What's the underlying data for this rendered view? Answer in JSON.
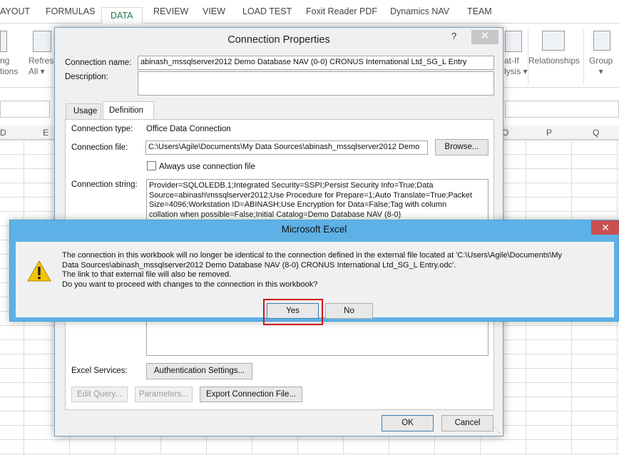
{
  "ribbon_tabs": [
    "AYOUT",
    "FORMULAS",
    "DATA",
    "REVIEW",
    "VIEW",
    "LOAD TEST",
    "Foxit Reader PDF",
    "Dynamics NAV",
    "TEAM"
  ],
  "ribbon": {
    "left_partial": [
      "ng",
      "tions"
    ],
    "refresh": [
      "Refresh",
      "All ▾"
    ],
    "whatif": [
      "at-If",
      "lysis ▾"
    ],
    "relationships": "Relationships",
    "group": [
      "Group",
      "▾"
    ]
  },
  "columns": [
    "D",
    "E",
    "O",
    "P",
    "Q"
  ],
  "connection_properties": {
    "title": "Connection Properties",
    "help": "?",
    "close": "✕",
    "connection_name_label": "Connection name:",
    "connection_name_value": "abinash_mssqlserver2012 Demo Database NAV (0-0) CRONUS International Ltd_SG_L Entry",
    "description_label": "Description:",
    "description_value": "",
    "tab_usage": "Usage",
    "tab_definition": "Definition",
    "connection_type_label": "Connection type:",
    "connection_type_value": "Office Data Connection",
    "connection_file_label": "Connection file:",
    "connection_file_value": "C:\\Users\\Agile\\Documents\\My Data Sources\\abinash_mssqlserver2012 Demo",
    "browse_label": "Browse...",
    "always_use_label": "Always use connection file",
    "connection_string_label": "Connection string:",
    "connection_string_lines": [
      "Provider=SQLOLEDB.1;Integrated Security=SSPI;Persist Security Info=True;Data",
      "Source=abinash\\mssqlserver2012;Use Procedure for Prepare=1;Auto Translate=True;Packet",
      "Size=4096;Workstation ID=ABINASH;Use Encryption for Data=False;Tag with column",
      "collation when possible=False;Initial Catalog=Demo Database NAV (8-0)"
    ],
    "excel_services_label": "Excel Services:",
    "auth_settings_label": "Authentication Settings...",
    "edit_query_label": "Edit Query...",
    "parameters_label": "Parameters...",
    "export_label": "Export Connection File...",
    "ok_label": "OK",
    "cancel_label": "Cancel"
  },
  "message_box": {
    "title": "Microsoft Excel",
    "close": "✕",
    "lines": [
      "The connection in this workbook will no longer be identical to the connection defined in the external file located at 'C:\\Users\\Agile\\Documents\\My",
      "Data Sources\\abinash_mssqlserver2012 Demo Database NAV (8-0) CRONUS International Ltd_SG_L Entry.odc'.",
      "The link to that external file will also be removed.",
      "Do you want to proceed with changes to the connection in this workbook?"
    ],
    "yes_label": "Yes",
    "no_label": "No"
  },
  "colors": {
    "excel_green": "#217346",
    "message_title_bar": "#5eb1e6",
    "highlight_border": "#d01515",
    "close_red": "#c75050"
  }
}
